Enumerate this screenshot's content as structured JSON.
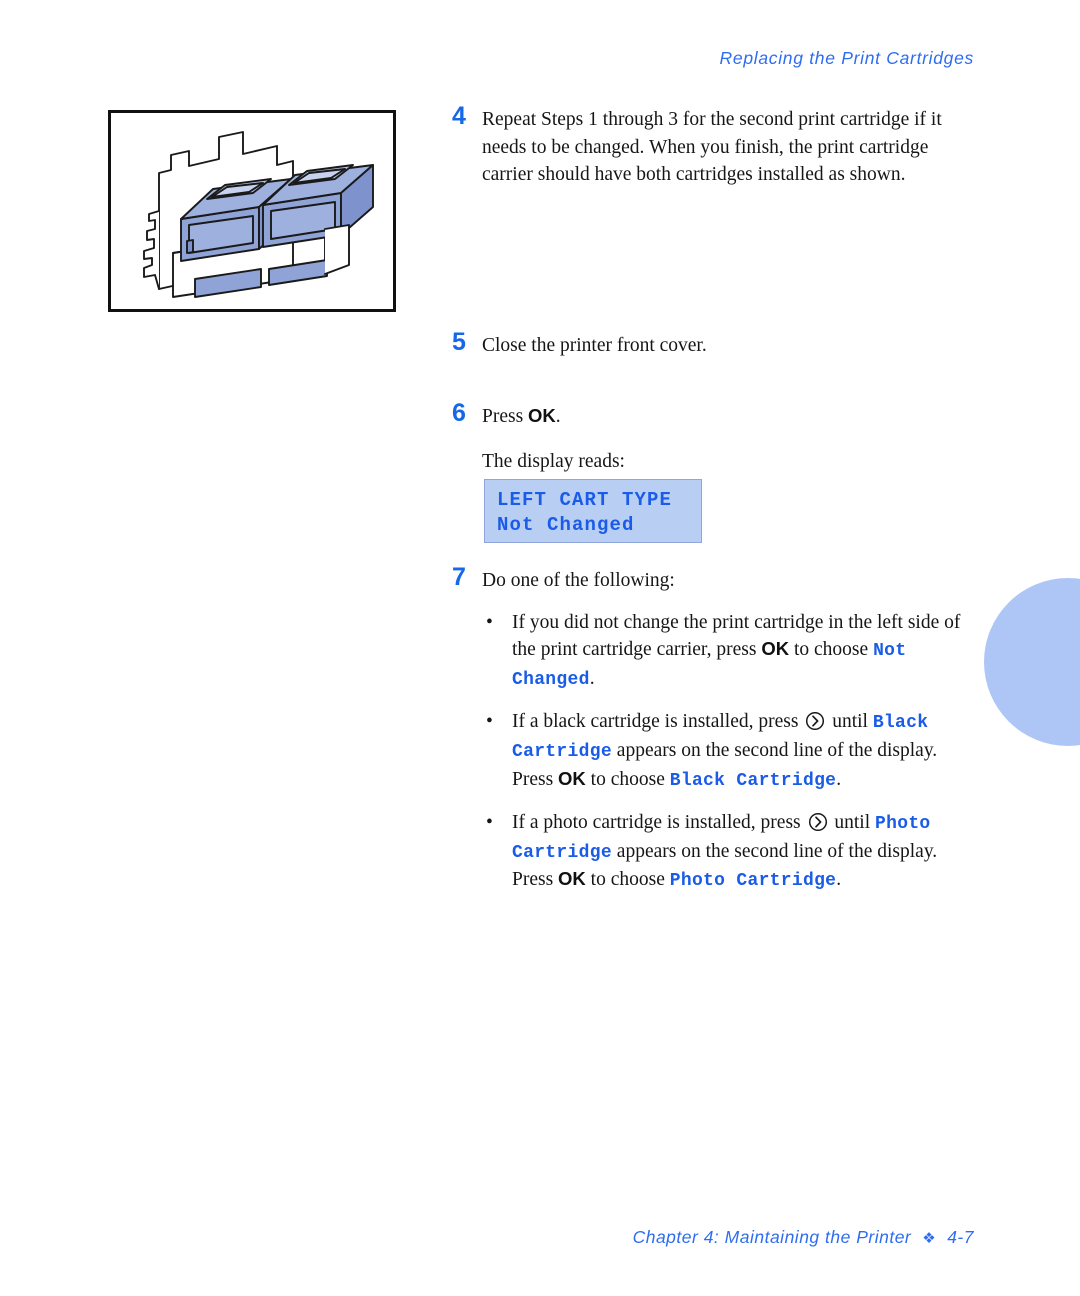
{
  "header": {
    "running_head": "Replacing the Print Cartridges"
  },
  "figure": {
    "caption_name": "print-cartridge-carrier-with-two-cartridges-installed"
  },
  "steps": [
    {
      "number": "4",
      "text": "Repeat Steps 1 through 3 for the second print cartridge if it needs to be changed. When you finish, the print cartridge carrier should have both cartridges installed as shown."
    },
    {
      "number": "5",
      "text": "Close the printer front cover."
    },
    {
      "number": "6",
      "press_label": "Press ",
      "key": "OK",
      "period": ".",
      "display_intro": "The display reads:"
    },
    {
      "number": "7",
      "text": "Do one of the following:"
    }
  ],
  "lcd": {
    "line1": "LEFT CART TYPE",
    "line2": "Not Changed",
    "background": "#b9cef3",
    "text_color": "#1a5ce8"
  },
  "bullets": [
    {
      "marker": "•",
      "part1": "If you did not change the print cartridge in the left side of the print cartridge carrier, press ",
      "key1": "OK",
      "part2": " to choose ",
      "mono1": "Not Changed",
      "part3": "."
    },
    {
      "marker": "•",
      "part1": "If a black cartridge is installed, press ",
      "icon": "right-arrow-circle-icon",
      "part2": " until ",
      "mono1": "Black Cartridge",
      "part3": " appears on the second line of the display. Press ",
      "key1": "OK",
      "part4": " to choose ",
      "mono2": "Black Cartridge",
      "part5": "."
    },
    {
      "marker": "•",
      "part1": "If a photo cartridge is installed, press ",
      "icon": "right-arrow-circle-icon",
      "part2": " until ",
      "mono1": "Photo Cartridge",
      "part3": " appears on the second line of the display. Press ",
      "key1": "OK",
      "part4": " to choose ",
      "mono2": "Photo Cartridge",
      "part5": "."
    }
  ],
  "footer": {
    "chapter": "Chapter 4: Maintaining the Printer",
    "diamond": "❖",
    "page": "4-7"
  },
  "colors": {
    "accent_blue": "#2f6df0",
    "step_number_blue": "#1668e8",
    "mono_blue": "#1a5ce8",
    "tab_blue": "#aec6f5",
    "cartridge_fill": "#8fa3d6"
  }
}
